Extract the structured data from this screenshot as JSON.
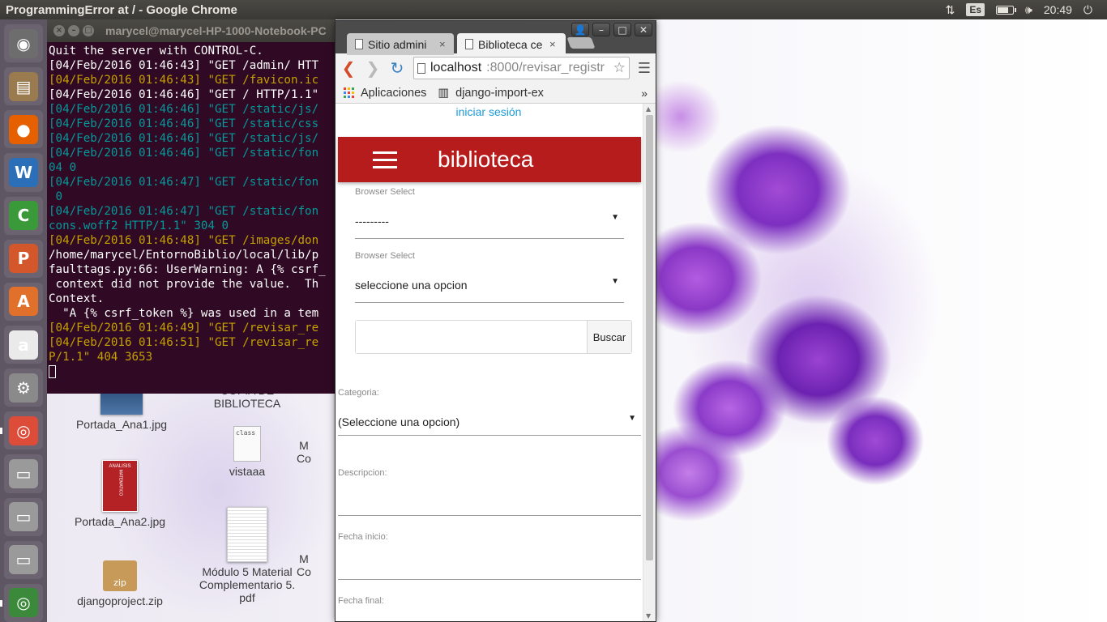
{
  "top_panel": {
    "title": "ProgrammingError at / - Google Chrome",
    "keyboard_layout": "Es",
    "battery_level": 0.7,
    "clock": "20:49"
  },
  "launcher": {
    "items": [
      {
        "name": "dash-icon",
        "glyph": "◉",
        "color": "#6d6d6d"
      },
      {
        "name": "files-icon",
        "glyph": "▤",
        "color": "#9a7b4f"
      },
      {
        "name": "firefox-icon",
        "glyph": "●",
        "color": "#e66000"
      },
      {
        "name": "writer-icon",
        "glyph": "W",
        "color": "#2a6fb8"
      },
      {
        "name": "calc-icon",
        "glyph": "C",
        "color": "#3a9a3a"
      },
      {
        "name": "impress-icon",
        "glyph": "P",
        "color": "#d4562b"
      },
      {
        "name": "software-center-icon",
        "glyph": "A",
        "color": "#e0702a"
      },
      {
        "name": "amazon-icon",
        "glyph": "a",
        "color": "#eaeaea"
      },
      {
        "name": "settings-icon",
        "glyph": "⚙",
        "color": "#8a8a8a"
      },
      {
        "name": "chrome-icon",
        "glyph": "◎",
        "color": "#dd4b39"
      },
      {
        "name": "drive-icon-1",
        "glyph": "▭",
        "color": "#9a9a9a"
      },
      {
        "name": "drive-icon-2",
        "glyph": "▭",
        "color": "#9a9a9a"
      },
      {
        "name": "drive-icon-3",
        "glyph": "▭",
        "color": "#9a9a9a"
      },
      {
        "name": "chrome-app-icon",
        "glyph": "◎",
        "color": "#3b8a3b"
      }
    ]
  },
  "terminal": {
    "title": "marycel@marycel-HP-1000-Notebook-PC",
    "lines": [
      {
        "text": "Quit the server with CONTROL-C.",
        "color": "white"
      },
      {
        "text": "[04/Feb/2016 01:46:43] \"GET /admin/ HTT",
        "color": "white"
      },
      {
        "text": "[04/Feb/2016 01:46:43] \"GET /favicon.ic",
        "color": "yellow"
      },
      {
        "text": "[04/Feb/2016 01:46:46] \"GET / HTTP/1.1\"",
        "color": "white"
      },
      {
        "text": "[04/Feb/2016 01:46:46] \"GET /static/js/",
        "color": "cyan"
      },
      {
        "text": "[04/Feb/2016 01:46:46] \"GET /static/css",
        "color": "cyan"
      },
      {
        "text": "[04/Feb/2016 01:46:46] \"GET /static/js/",
        "color": "cyan"
      },
      {
        "text": "[04/Feb/2016 01:46:46] \"GET /static/fon",
        "color": "cyan"
      },
      {
        "text": "04 0",
        "color": "cyan"
      },
      {
        "text": "[04/Feb/2016 01:46:47] \"GET /static/fon",
        "color": "cyan"
      },
      {
        "text": " 0",
        "color": "cyan"
      },
      {
        "text": "[04/Feb/2016 01:46:47] \"GET /static/fon",
        "color": "cyan"
      },
      {
        "text": "cons.woff2 HTTP/1.1\" 304 0",
        "color": "cyan"
      },
      {
        "text": "[04/Feb/2016 01:46:48] \"GET /images/don",
        "color": "yellow"
      },
      {
        "text": "/home/marycel/EntornoBiblio/local/lib/p",
        "color": "white"
      },
      {
        "text": "faulttags.py:66: UserWarning: A {% csrf_",
        "color": "white"
      },
      {
        "text": " context did not provide the value.  Th",
        "color": "white"
      },
      {
        "text": "Context.",
        "color": "white"
      },
      {
        "text": "  \"A {% csrf_token %} was used in a tem",
        "color": "white"
      },
      {
        "text": "",
        "color": "white"
      },
      {
        "text": "[04/Feb/2016 01:46:49] \"GET /revisar_re",
        "color": "yellow"
      },
      {
        "text": "[04/Feb/2016 01:46:51] \"GET /revisar_re",
        "color": "yellow"
      },
      {
        "text": "P/1.1\" 404 3653",
        "color": "yellow"
      }
    ]
  },
  "desktop": {
    "icons": [
      {
        "label": "Portada_Ana1.jpg"
      },
      {
        "label": "COPIA DE\nBIBLIOTECA"
      },
      {
        "label": "vistaaa",
        "glyph_text": "class"
      },
      {
        "label": "Portada_Ana2.jpg",
        "cover_title": "ANALISIS",
        "cover_subtitle": "MATEMATICO"
      },
      {
        "label": "Módulo 5 Material\nComplementario 5.\npdf"
      },
      {
        "label": "djangoproject.zip",
        "glyph_text": "zip"
      },
      {
        "label": "M\nCo"
      },
      {
        "label": "M\nCo"
      }
    ]
  },
  "browser": {
    "tabs": [
      {
        "label": "Sitio admini",
        "close": "×"
      },
      {
        "label": "Biblioteca ce",
        "close": "×"
      }
    ],
    "url_host": "localhost",
    "url_path": ":8000/revisar_registr",
    "bookmarks": {
      "apps_label": "Aplicaciones",
      "item": "django-import-ex",
      "overflow": "»"
    },
    "page": {
      "login_link": "iniciar sesión",
      "header_title": "biblioteca",
      "header_color": "#b71c1c",
      "select1": {
        "label": "Browser Select",
        "value": "---------"
      },
      "select2": {
        "label": "Browser Select",
        "value": "seleccione una opcion"
      },
      "search": {
        "placeholder": "",
        "button": "Buscar"
      },
      "categoria": {
        "label": "Categoria:",
        "value": "(Seleccione una opcion)"
      },
      "descripcion": {
        "label": "Descripcion:"
      },
      "fecha_inicio": {
        "label": "Fecha inicio:"
      },
      "fecha_final": {
        "label": "Fecha final:"
      }
    }
  }
}
